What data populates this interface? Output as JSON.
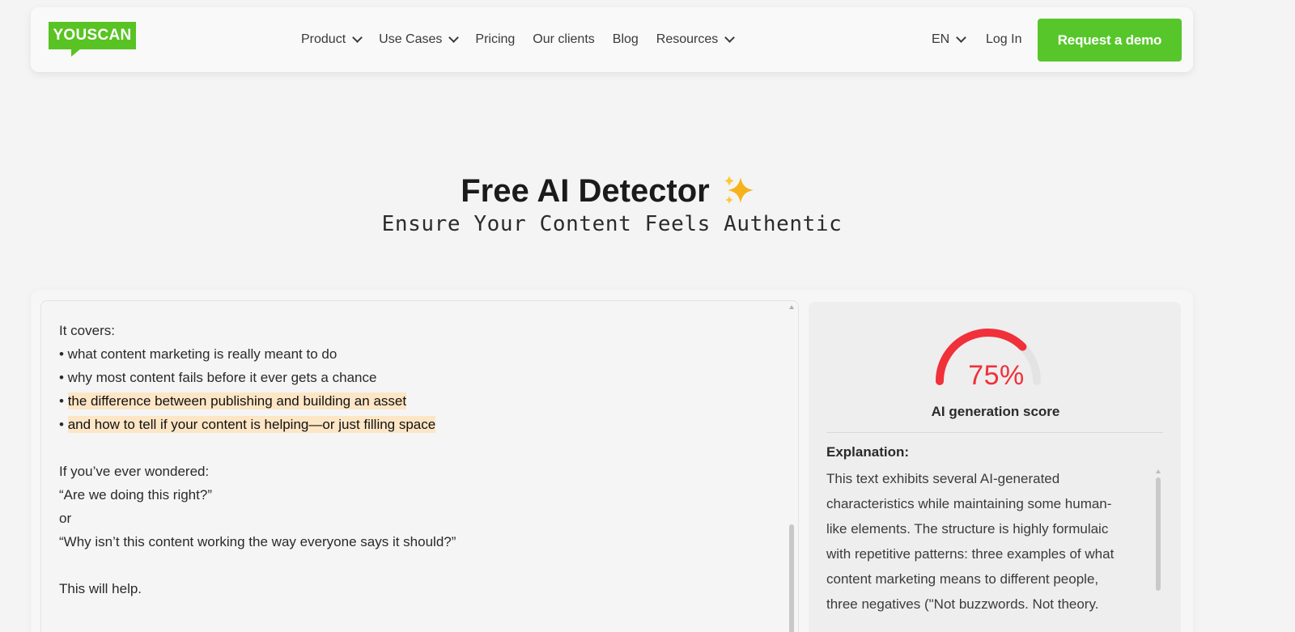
{
  "header": {
    "logo_text": "YOUSCAN",
    "nav": [
      {
        "label": "Product",
        "has_dropdown": true
      },
      {
        "label": "Use Cases",
        "has_dropdown": true
      },
      {
        "label": "Pricing",
        "has_dropdown": false
      },
      {
        "label": "Our clients",
        "has_dropdown": false
      },
      {
        "label": "Blog",
        "has_dropdown": false
      },
      {
        "label": "Resources",
        "has_dropdown": true
      }
    ],
    "language": "EN",
    "login_label": "Log In",
    "cta_label": "Request a demo"
  },
  "hero": {
    "title": "Free AI Detector",
    "title_icon": "sparkles-icon",
    "subtitle": "Ensure Your Content Feels Authentic"
  },
  "input": {
    "lines": [
      {
        "text": "It covers:",
        "highlight": false
      },
      {
        "text": "• what content marketing is really meant to do",
        "highlight": false
      },
      {
        "text": "• why most content fails before it ever gets a chance",
        "highlight": false
      },
      {
        "bullet": "• ",
        "text": "the difference between publishing and building an asset",
        "highlight": true
      },
      {
        "bullet": "• ",
        "text": "and how to tell if your content is helping—or just filling space",
        "highlight": true
      },
      {
        "text": "",
        "highlight": false
      },
      {
        "text": "If you’ve ever wondered:",
        "highlight": false
      },
      {
        "text": "“Are we doing this right?”",
        "highlight": false
      },
      {
        "text": "or",
        "highlight": false
      },
      {
        "text": "“Why isn’t this content working the way everyone says it should?”",
        "highlight": false
      },
      {
        "text": "",
        "highlight": false
      },
      {
        "text": "This will help.",
        "highlight": false
      }
    ]
  },
  "result": {
    "score": 75,
    "score_text": "75%",
    "score_label": "AI generation score",
    "explanation_title": "Explanation:",
    "explanation_lines": [
      "This text exhibits several AI-generated",
      "characteristics while maintaining some human-",
      "like elements. The structure is highly formulaic",
      "with repetitive patterns: three examples of what",
      "content marketing means to different people,",
      "three negatives (\"Not buzzwords. Not theory."
    ],
    "gauge_color": "#f0313a",
    "gauge_track_color": "#e3e3e3"
  },
  "colors": {
    "brand_green": "#58c322",
    "highlight": "#fde6c5"
  }
}
